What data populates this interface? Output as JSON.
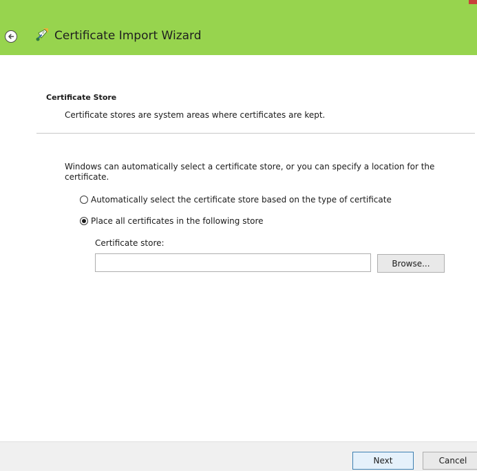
{
  "window": {
    "title": "Certificate Import Wizard",
    "header_color": "#97d44e"
  },
  "section": {
    "heading": "Certificate Store",
    "description": "Certificate stores are system areas where certificates are kept."
  },
  "body": {
    "intro": "Windows can automatically select a certificate store, or you can specify a location for the certificate.",
    "options": [
      {
        "label": "Automatically select the certificate store based on the type of certificate",
        "selected": false
      },
      {
        "label": "Place all certificates in the following store",
        "selected": true
      }
    ],
    "store_label": "Certificate store:",
    "store_value": "",
    "browse_label": "Browse..."
  },
  "footer": {
    "next_label": "Next",
    "cancel_label": "Cancel"
  },
  "icons": {
    "back": "back-arrow-icon",
    "wizard": "certificate-wizard-icon"
  }
}
